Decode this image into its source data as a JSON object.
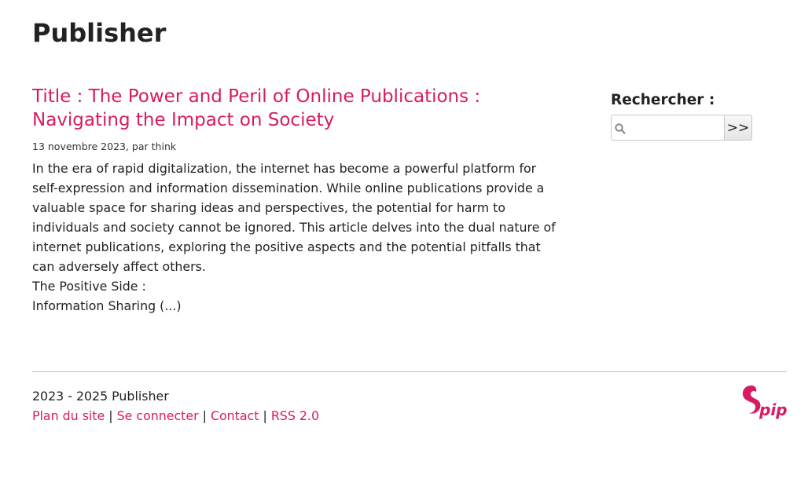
{
  "site": {
    "title": "Publisher"
  },
  "article": {
    "title": "Title : The Power and Peril of Online Publications : Navigating the Impact on Society",
    "meta": "13 novembre 2023, par think",
    "paragraphs": [
      "In the era of rapid digitalization, the internet has become a powerful platform for self-expression and information dissemination. While online publications provide a valuable space for sharing ideas and perspectives, the potential for harm to individuals and society cannot be ignored. This article delves into the dual nature of internet publications, exploring the positive aspects and the potential pitfalls that can adversely affect others.",
      "The Positive Side :",
      "Information Sharing (...)"
    ]
  },
  "sidebar": {
    "search_label": "Rechercher :",
    "search_value": "",
    "search_button": ">>",
    "search_icon": "magnifier-icon"
  },
  "footer": {
    "copyright": "2023 - 2025 Publisher",
    "links": [
      "Plan du site",
      "Se connecter",
      "Contact",
      "RSS 2.0"
    ],
    "separator": "|",
    "logo": "spip-logo"
  },
  "colors": {
    "accent": "#d81b60",
    "text": "#222222",
    "rule": "#bdbdbd"
  }
}
